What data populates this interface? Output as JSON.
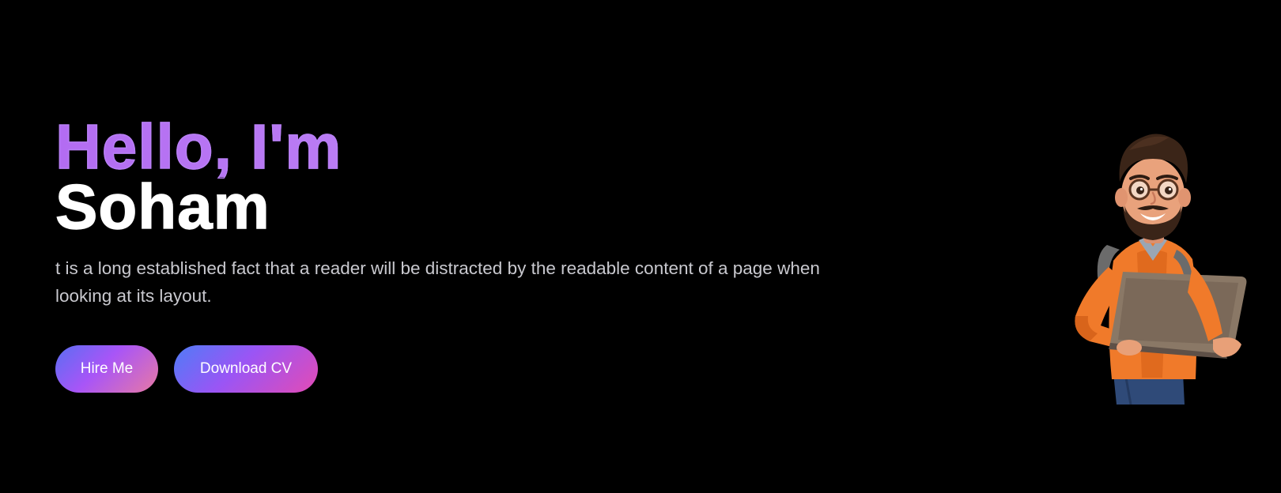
{
  "hero": {
    "greeting": "Hello, I'm",
    "name": "Soham",
    "description": "t is a long established fact that a reader will be distracted by the readable content of a page when looking at its layout.",
    "buttons": {
      "hire_label": "Hire Me",
      "download_label": "Download CV"
    },
    "image_subject": "cartoon-developer-with-laptop"
  },
  "colors": {
    "background": "#000000",
    "greeting": "#c084fc",
    "name": "#ffffff",
    "description": "#c9c9cf",
    "button_gradient_start": "#5a6ef3",
    "button_gradient_mid": "#a855f7",
    "button_gradient_end": "#e34bb5"
  }
}
